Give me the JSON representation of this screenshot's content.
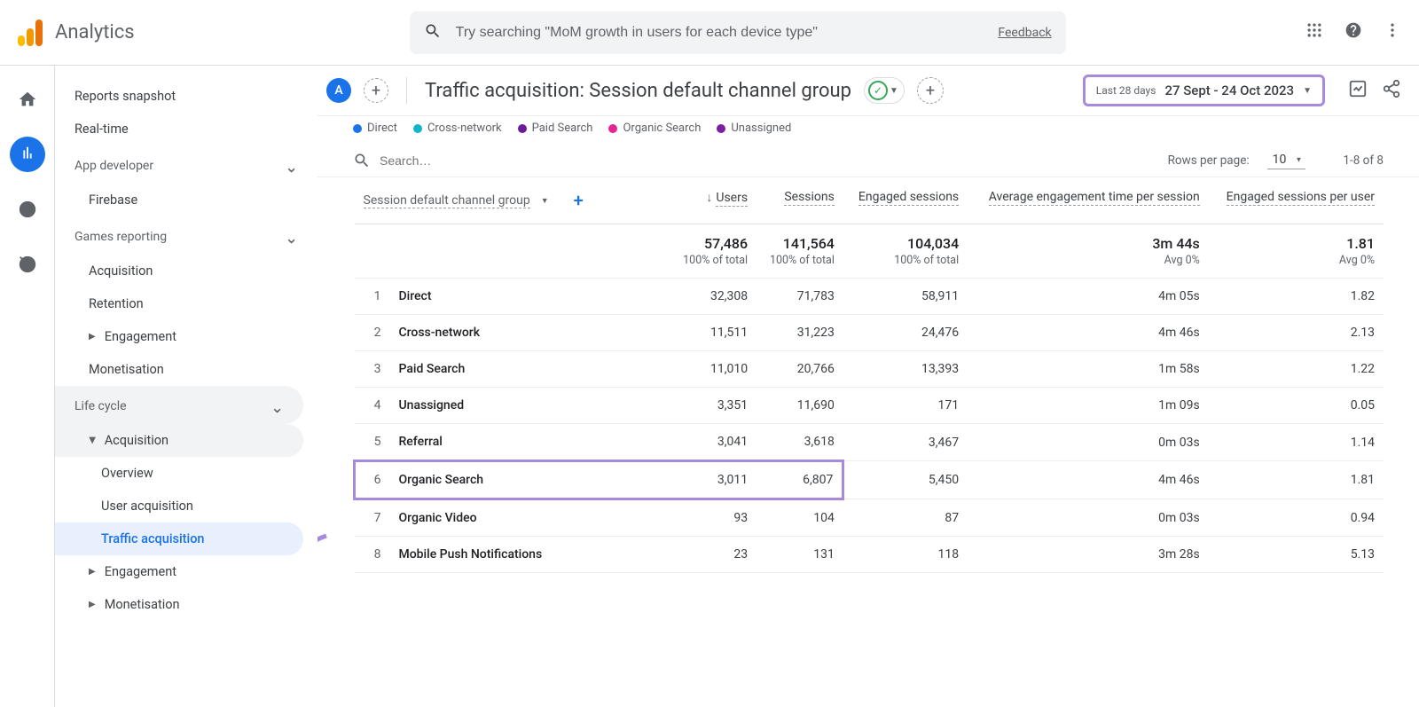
{
  "app": {
    "name": "Analytics"
  },
  "search": {
    "placeholder": "Try searching \"MoM growth in users for each device type\"",
    "feedback": "Feedback"
  },
  "sidebar": {
    "items": [
      {
        "label": "Reports snapshot"
      },
      {
        "label": "Real-time"
      }
    ],
    "app_dev_header": "App developer",
    "app_dev": [
      {
        "label": "Firebase"
      }
    ],
    "games_header": "Games reporting",
    "games": [
      {
        "label": "Acquisition"
      },
      {
        "label": "Retention"
      },
      {
        "label": "Engagement"
      },
      {
        "label": "Monetisation"
      }
    ],
    "life_cycle_header": "Life cycle",
    "life_cycle": {
      "acquisition": "Acquisition",
      "acq_items": [
        {
          "label": "Overview"
        },
        {
          "label": "User acquisition"
        },
        {
          "label": "Traffic acquisition"
        }
      ],
      "engagement": "Engagement",
      "monetisation": "Monetisation"
    }
  },
  "report": {
    "letter": "A",
    "title": "Traffic acquisition: Session default channel group",
    "date_prefix": "Last 28 days",
    "date_range": "27 Sept - 24 Oct 2023"
  },
  "legend": [
    {
      "label": "Direct",
      "color": "#1a73e8"
    },
    {
      "label": "Cross-network",
      "color": "#12b5cb"
    },
    {
      "label": "Paid Search",
      "color": "#6a1b9a"
    },
    {
      "label": "Organic Search",
      "color": "#e52592"
    },
    {
      "label": "Unassigned",
      "color": "#7b1fa2"
    }
  ],
  "table": {
    "search_placeholder": "Search…",
    "rows_per_page_label": "Rows per page:",
    "rows_per_page": "10",
    "page_info": "1-8 of 8",
    "dim_header": "Session default channel group",
    "columns": [
      "Users",
      "Sessions",
      "Engaged sessions",
      "Average engagement time per session",
      "Engaged sessions per user"
    ],
    "totals": {
      "users": "57,486",
      "users_sub": "100% of total",
      "sessions": "141,564",
      "sessions_sub": "100% of total",
      "engaged": "104,034",
      "engaged_sub": "100% of total",
      "avg_time": "3m 44s",
      "avg_time_sub": "Avg 0%",
      "eng_per_user": "1.81",
      "eng_per_user_sub": "Avg 0%"
    },
    "rows": [
      {
        "n": "1",
        "name": "Direct",
        "users": "32,308",
        "sessions": "71,783",
        "engaged": "58,911",
        "avg_time": "4m 05s",
        "eng_per_user": "1.82"
      },
      {
        "n": "2",
        "name": "Cross-network",
        "users": "11,511",
        "sessions": "31,223",
        "engaged": "24,476",
        "avg_time": "4m 46s",
        "eng_per_user": "2.13"
      },
      {
        "n": "3",
        "name": "Paid Search",
        "users": "11,010",
        "sessions": "20,766",
        "engaged": "13,393",
        "avg_time": "1m 58s",
        "eng_per_user": "1.22"
      },
      {
        "n": "4",
        "name": "Unassigned",
        "users": "3,351",
        "sessions": "11,690",
        "engaged": "171",
        "avg_time": "1m 09s",
        "eng_per_user": "0.05"
      },
      {
        "n": "5",
        "name": "Referral",
        "users": "3,041",
        "sessions": "3,618",
        "engaged": "3,467",
        "avg_time": "0m 03s",
        "eng_per_user": "1.14"
      },
      {
        "n": "6",
        "name": "Organic Search",
        "users": "3,011",
        "sessions": "6,807",
        "engaged": "5,450",
        "avg_time": "4m 46s",
        "eng_per_user": "1.81",
        "highlight": true
      },
      {
        "n": "7",
        "name": "Organic Video",
        "users": "93",
        "sessions": "104",
        "engaged": "87",
        "avg_time": "0m 03s",
        "eng_per_user": "0.94"
      },
      {
        "n": "8",
        "name": "Mobile Push Notifications",
        "users": "23",
        "sessions": "131",
        "engaged": "118",
        "avg_time": "3m 28s",
        "eng_per_user": "5.13"
      }
    ]
  }
}
